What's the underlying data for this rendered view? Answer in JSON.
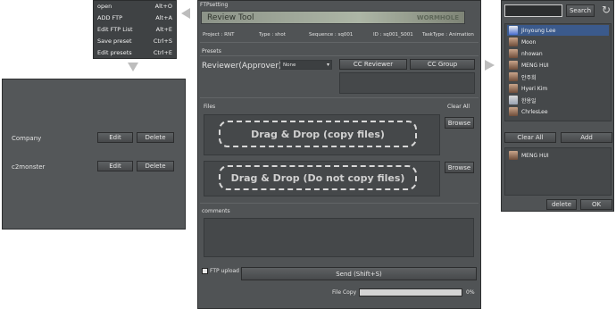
{
  "menu": {
    "items": [
      {
        "label": "open",
        "shortcut": "Alt+O"
      },
      {
        "label": "ADD FTP",
        "shortcut": "Alt+A"
      },
      {
        "label": "Edit FTP List",
        "shortcut": "Alt+E"
      },
      {
        "label": "Save preset",
        "shortcut": "Ctrl+S"
      },
      {
        "label": "Edit presets",
        "shortcut": "Ctrl+E"
      }
    ]
  },
  "ftp_list": {
    "rows": [
      {
        "name": "Company",
        "edit_label": "Edit",
        "delete_label": "Delete"
      },
      {
        "name": "c2monster",
        "edit_label": "Edit",
        "delete_label": "Delete"
      }
    ]
  },
  "main": {
    "window_title": "FTPsetting",
    "banner_title": "Review Tool",
    "banner_brand": "WORMHOLE",
    "info": {
      "project": "Project : RNT",
      "type": "Type : shot",
      "sequence": "Sequence : sq001",
      "id": "ID : sq001_S001",
      "tasktype": "TaskType : Animation"
    },
    "presets_label": "Presets",
    "reviewer_label": "Reviewer(Approver)",
    "reviewer_select": "None",
    "cc_reviewer_label": "CC Reviewer",
    "cc_group_label": "CC Group",
    "files_label": "Files",
    "clear_all_label": "Clear All",
    "browse_label": "Browse",
    "drop_copy": "Drag & Drop (copy files)",
    "drop_nocopy": "Drag & Drop (Do not copy files)",
    "comments_label": "comments",
    "ftp_upload_label": "FTP upload",
    "send_label": "Send (Shift+S)",
    "filecopy_label": "File Copy",
    "progress_text": "0%",
    "progress_value": 0
  },
  "users": {
    "search_label": "Search",
    "search_value": "",
    "list": [
      "Jinyoung Lee",
      "Moon",
      "nhowan",
      "MENG HUI",
      "안주희",
      "Hyeri Kim",
      "한용일",
      "ChrlesLee"
    ],
    "clear_all_label": "Clear All",
    "add_label": "Add",
    "selected": [
      "MENG HUI"
    ],
    "delete_label": "delete",
    "ok_label": "OK"
  }
}
